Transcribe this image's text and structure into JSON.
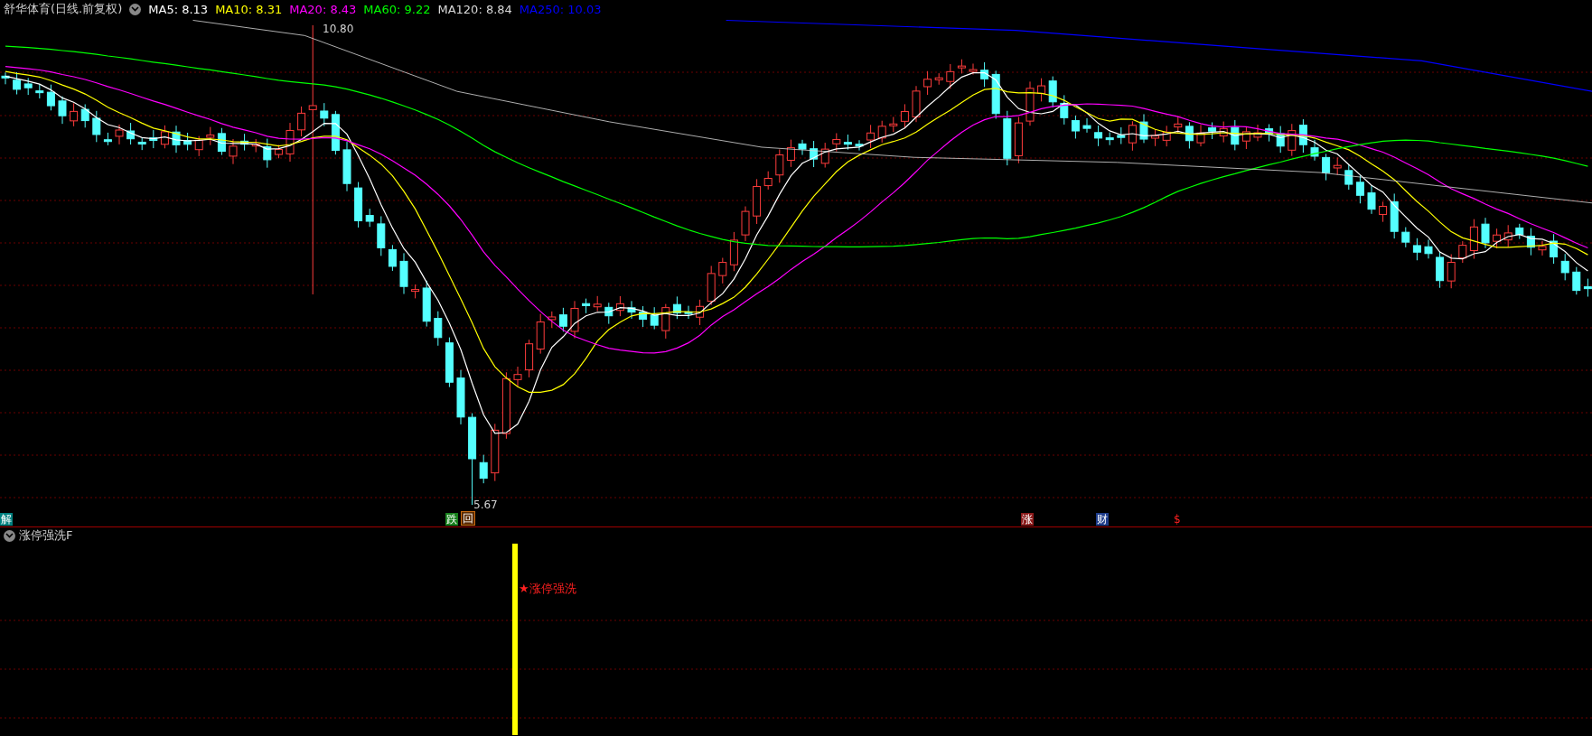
{
  "header": {
    "title": "舒华体育(日线.前复权)",
    "indicators": [
      {
        "label": "MA5: 8.13",
        "color": "#ffffff"
      },
      {
        "label": "MA10: 8.31",
        "color": "#ffff00"
      },
      {
        "label": "MA20: 8.43",
        "color": "#ff00ff"
      },
      {
        "label": "MA60: 9.22",
        "color": "#00ff00"
      },
      {
        "label": "MA120: 8.84",
        "color": "#d8d8d8"
      },
      {
        "label": "MA250: 10.03",
        "color": "#0000ff"
      }
    ]
  },
  "price_labels": {
    "high": "10.80",
    "low": "5.67"
  },
  "signals": [
    {
      "text": "解",
      "kind": "tag",
      "color": "#00807f"
    },
    {
      "text": "跌",
      "kind": "tag",
      "color": "#17801c"
    },
    {
      "text": "回",
      "kind": "boxed",
      "color": "#c86a10"
    },
    {
      "text": "涨",
      "kind": "tag",
      "color": "#8c1b1b"
    },
    {
      "text": "财",
      "kind": "tag",
      "color": "#1e3c8a"
    },
    {
      "text": "$",
      "kind": "plain",
      "color": "#ff2020"
    }
  ],
  "sub_panel": {
    "title": "涨停强洗F",
    "signal_label": "★涨停强洗"
  }
}
